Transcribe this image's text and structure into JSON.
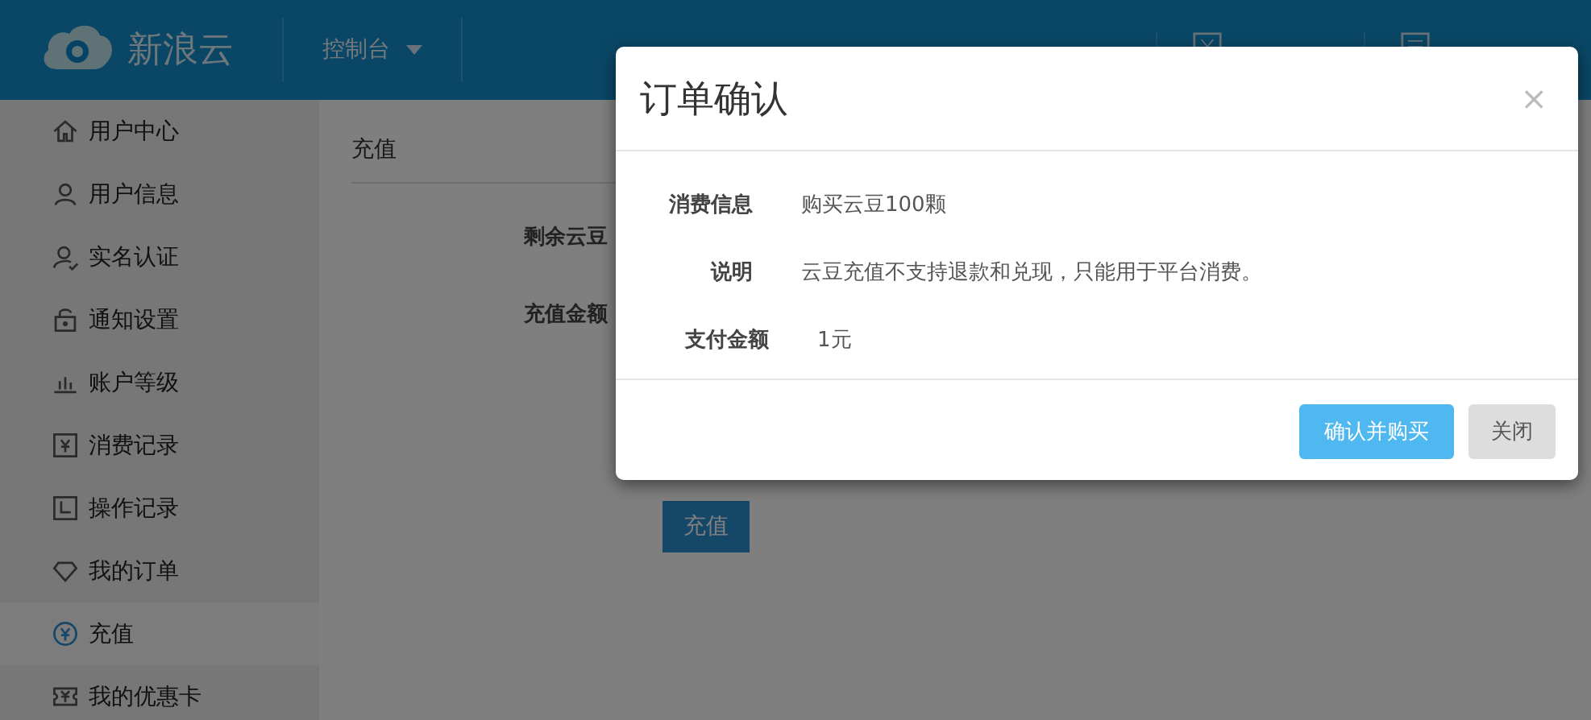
{
  "header": {
    "logo": "新浪云",
    "console": "控制台"
  },
  "sidebar": {
    "items": [
      {
        "label": "用户中心",
        "kind": "home",
        "selected": false
      },
      {
        "label": "用户信息",
        "kind": "user",
        "selected": false
      },
      {
        "label": "实名认证",
        "kind": "verify",
        "selected": false
      },
      {
        "label": "通知设置",
        "kind": "notify",
        "selected": false
      },
      {
        "label": "账户等级",
        "kind": "level",
        "selected": false
      },
      {
        "label": "消费记录",
        "kind": "spend",
        "selected": false
      },
      {
        "label": "操作记录",
        "kind": "log",
        "selected": false
      },
      {
        "label": "我的订单",
        "kind": "order",
        "selected": false
      },
      {
        "label": "充值",
        "kind": "recharge",
        "selected": true
      },
      {
        "label": "我的优惠卡",
        "kind": "card",
        "selected": false
      }
    ]
  },
  "content": {
    "title": "充值",
    "labels": [
      "剩余云豆",
      "充值金额"
    ],
    "submit": "充值"
  },
  "dialog": {
    "title": "订单确认",
    "close": "×",
    "rows": [
      {
        "label": "消费信息",
        "value": "购买云豆100颗"
      },
      {
        "label": "说明",
        "value": "云豆充值不支持退款和兑现，只能用于平台消费。"
      },
      {
        "label": "支付金额",
        "value": "1元"
      }
    ],
    "confirm": "确认并购买",
    "cancel": "关闭"
  }
}
